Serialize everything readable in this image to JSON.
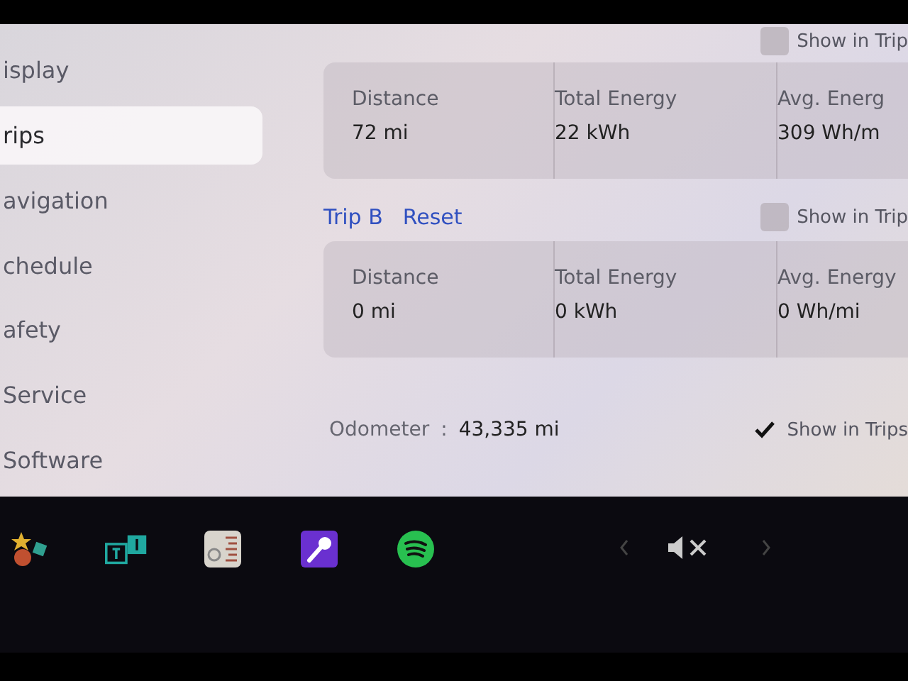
{
  "sidebar": {
    "items": [
      {
        "label": "isplay",
        "selected": false
      },
      {
        "label": "rips",
        "selected": true
      },
      {
        "label": "avigation",
        "selected": false
      },
      {
        "label": "chedule",
        "selected": false
      },
      {
        "label": "afety",
        "selected": false
      },
      {
        "label": "Service",
        "selected": false
      },
      {
        "label": "Software",
        "selected": false
      }
    ]
  },
  "trip_a": {
    "show_in_trips": {
      "label": "Show in Trip",
      "checked": false
    },
    "stats": [
      {
        "label": "Distance",
        "value": "72 mi"
      },
      {
        "label": "Total Energy",
        "value": "22 kWh"
      },
      {
        "label": "Avg. Energ",
        "value": "309 Wh/m"
      }
    ]
  },
  "trip_b": {
    "title": "Trip B",
    "reset": "Reset",
    "show_in_trips": {
      "label": "Show in Trip",
      "checked": false
    },
    "stats": [
      {
        "label": "Distance",
        "value": "0 mi"
      },
      {
        "label": "Total Energy",
        "value": "0 kWh"
      },
      {
        "label": "Avg. Energy",
        "value": "0 Wh/mi"
      }
    ]
  },
  "odometer": {
    "label": "Odometer",
    "separator": ":",
    "value": "43,335 mi",
    "show_in_trips": {
      "label": "Show in Trips",
      "checked": true
    }
  },
  "dock": {
    "apps": [
      {
        "kind": "games"
      },
      {
        "kind": "tiles"
      },
      {
        "kind": "radio"
      },
      {
        "kind": "karaoke"
      },
      {
        "kind": "music"
      }
    ],
    "volume": {
      "muted": true
    }
  }
}
